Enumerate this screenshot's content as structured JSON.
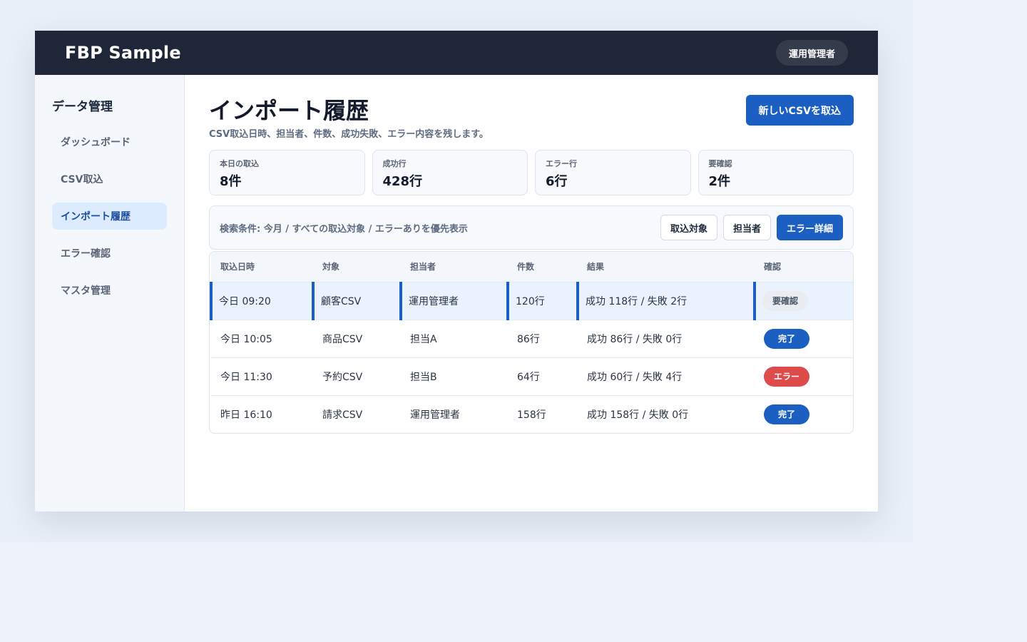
{
  "app": {
    "brand": "FBP Sample",
    "user_label": "運用管理者"
  },
  "sidebar": {
    "title": "データ管理",
    "items": [
      {
        "label": "ダッシュボード",
        "active": false
      },
      {
        "label": "CSV取込",
        "active": false
      },
      {
        "label": "インポート履歴",
        "active": true
      },
      {
        "label": "エラー確認",
        "active": false
      },
      {
        "label": "マスタ管理",
        "active": false
      }
    ]
  },
  "main": {
    "title": "インポート履歴",
    "subtitle": "CSV取込日時、担当者、件数、成功失敗、エラー内容を残します。",
    "new_import_label": "新しいCSVを取込"
  },
  "stats": [
    {
      "label": "本日の取込",
      "value": "8件"
    },
    {
      "label": "成功行",
      "value": "428行"
    },
    {
      "label": "エラー行",
      "value": "6行"
    },
    {
      "label": "要確認",
      "value": "2件"
    }
  ],
  "filter": {
    "text": "検索条件: 今月 / すべての取込対象 / エラーありを優先表示",
    "buttons": [
      {
        "label": "取込対象",
        "active": false
      },
      {
        "label": "担当者",
        "active": false
      },
      {
        "label": "エラー詳細",
        "active": true
      }
    ]
  },
  "table": {
    "columns": [
      "取込日時",
      "対象",
      "担当者",
      "件数",
      "結果",
      "確認"
    ],
    "rows": [
      {
        "datetime": "今日 09:20",
        "target": "顧客CSV",
        "owner": "運用管理者",
        "count": "120行",
        "result": "成功 118行 / 失敗 2行",
        "status": "要確認",
        "status_type": "review",
        "selected": true
      },
      {
        "datetime": "今日 10:05",
        "target": "商品CSV",
        "owner": "担当A",
        "count": "86行",
        "result": "成功 86行 / 失敗 0行",
        "status": "完了",
        "status_type": "done",
        "selected": false
      },
      {
        "datetime": "今日 11:30",
        "target": "予約CSV",
        "owner": "担当B",
        "count": "64行",
        "result": "成功 60行 / 失敗 4行",
        "status": "エラー",
        "status_type": "error",
        "selected": false
      },
      {
        "datetime": "昨日 16:10",
        "target": "請求CSV",
        "owner": "運用管理者",
        "count": "158行",
        "result": "成功 158行 / 失敗 0行",
        "status": "完了",
        "status_type": "done",
        "selected": false
      }
    ]
  },
  "colors": {
    "topbar": "#1e2637",
    "accent": "#1c5fc3",
    "error": "#dd4b4b",
    "selected_row": "#eaf2fd"
  }
}
